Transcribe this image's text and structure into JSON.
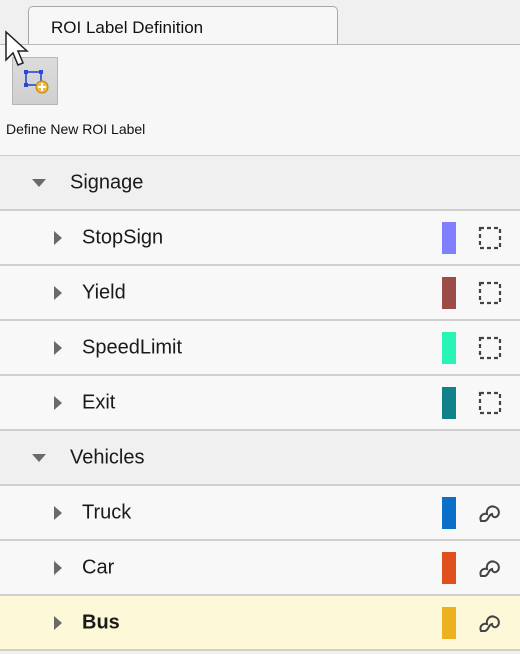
{
  "tab": {
    "label": "ROI Label Definition"
  },
  "toolstrip": {
    "define_button_icon": "rectangle-add-icon",
    "define_label": "Define New ROI Label"
  },
  "groups": [
    {
      "name": "Signage",
      "expanded": true,
      "labels": [
        {
          "name": "StopSign",
          "color": "#8080ff",
          "shape_icon": "rectangle-roi-icon",
          "selected": false
        },
        {
          "name": "Yield",
          "color": "#9c4b46",
          "shape_icon": "rectangle-roi-icon",
          "selected": false
        },
        {
          "name": "SpeedLimit",
          "color": "#27f5b8",
          "shape_icon": "rectangle-roi-icon",
          "selected": false
        },
        {
          "name": "Exit",
          "color": "#12828a",
          "shape_icon": "rectangle-roi-icon",
          "selected": false
        }
      ]
    },
    {
      "name": "Vehicles",
      "expanded": true,
      "labels": [
        {
          "name": "Truck",
          "color": "#0a6fc9",
          "shape_icon": "cuboid-roi-icon",
          "selected": false
        },
        {
          "name": "Car",
          "color": "#e0501c",
          "shape_icon": "cuboid-roi-icon",
          "selected": false
        },
        {
          "name": "Bus",
          "color": "#edb120",
          "shape_icon": "cuboid-roi-icon",
          "selected": true
        }
      ]
    }
  ],
  "colors": {
    "selected_row": "#fdf8d7",
    "group_row": "#f0f0f0",
    "label_row": "#f8f8f8"
  }
}
